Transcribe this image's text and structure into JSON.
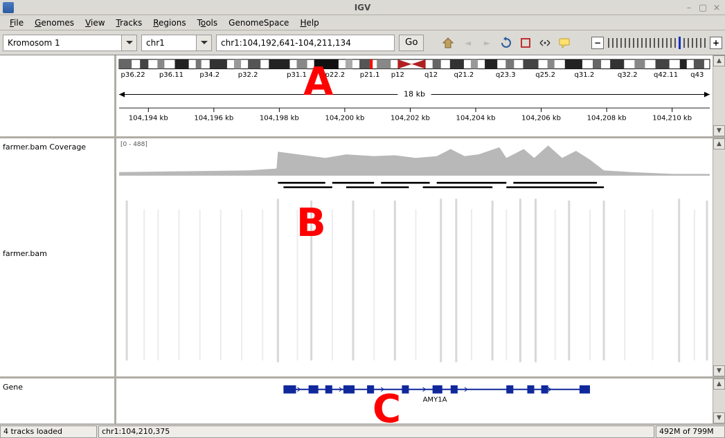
{
  "window": {
    "title": "IGV"
  },
  "menu": [
    "File",
    "Genomes",
    "View",
    "Tracks",
    "Regions",
    "Tools",
    "GenomeSpace",
    "Help"
  ],
  "toolbar": {
    "genome_select": "Kromosom 1",
    "chrom_select": "chr1",
    "location": "chr1:104,192,641-104,211,134",
    "go_label": "Go"
  },
  "ideogram": {
    "span_label": "18 kb",
    "bands": [
      "p36.22",
      "p36.11",
      "p34.2",
      "p32.2",
      "p31.1",
      "p22.2",
      "p21.1",
      "p12",
      "q12",
      "q21.2",
      "q23.3",
      "q25.2",
      "q31.2",
      "q32.2",
      "q42.11",
      "q43"
    ],
    "ruler_ticks": [
      "104,194 kb",
      "104,196 kb",
      "104,198 kb",
      "104,200 kb",
      "104,202 kb",
      "104,204 kb",
      "104,206 kb",
      "104,208 kb",
      "104,210 kb"
    ]
  },
  "tracks": {
    "coverage_name": "farmer.bam Coverage",
    "coverage_range": "[0 - 488]",
    "bam_name": "farmer.bam",
    "gene_track_name": "Gene",
    "gene_name": "AMY1A"
  },
  "annotations": {
    "A": "A",
    "B": "B",
    "C": "C"
  },
  "status": {
    "left": "4 tracks loaded",
    "mid": "chr1:104,210,375",
    "right": "492M of 799M"
  }
}
